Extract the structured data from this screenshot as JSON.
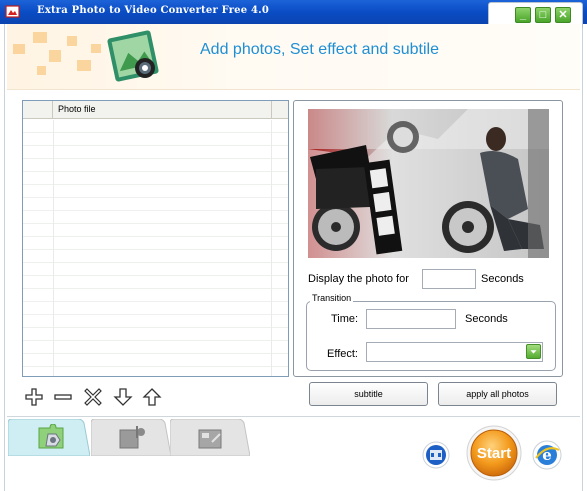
{
  "window": {
    "title": "Extra Photo to Video Converter Free 4.0",
    "minimize_glyph": "_",
    "maximize_glyph": "□",
    "close_glyph": "✕"
  },
  "banner": {
    "heading": "Add photos, Set effect and subtile"
  },
  "photo_list": {
    "column_header": "Photo file",
    "items": []
  },
  "toolbar": {
    "add_icon": "plus-icon",
    "remove_icon": "minus-icon",
    "clear_icon": "x-icon",
    "move_down_icon": "arrow-down-icon",
    "move_up_icon": "arrow-up-icon"
  },
  "settings": {
    "display_label": "Display the photo for",
    "display_value": "",
    "display_unit": "Seconds",
    "transition_legend": "Transition",
    "time_label": "Time:",
    "time_value": "",
    "time_unit": "Seconds",
    "effect_label": "Effect:",
    "effect_value": ""
  },
  "buttons": {
    "subtitle": "subtitle",
    "apply_all": "apply all photos",
    "start": "Start"
  },
  "tabs": [
    {
      "name": "photos",
      "active": true
    },
    {
      "name": "audio",
      "active": false
    },
    {
      "name": "output",
      "active": false
    }
  ],
  "colors": {
    "titlebar": "#0a4cc4",
    "banner_text": "#1f8fd4",
    "start_button": "#f39a1c",
    "window_control": "#4aa52a"
  }
}
